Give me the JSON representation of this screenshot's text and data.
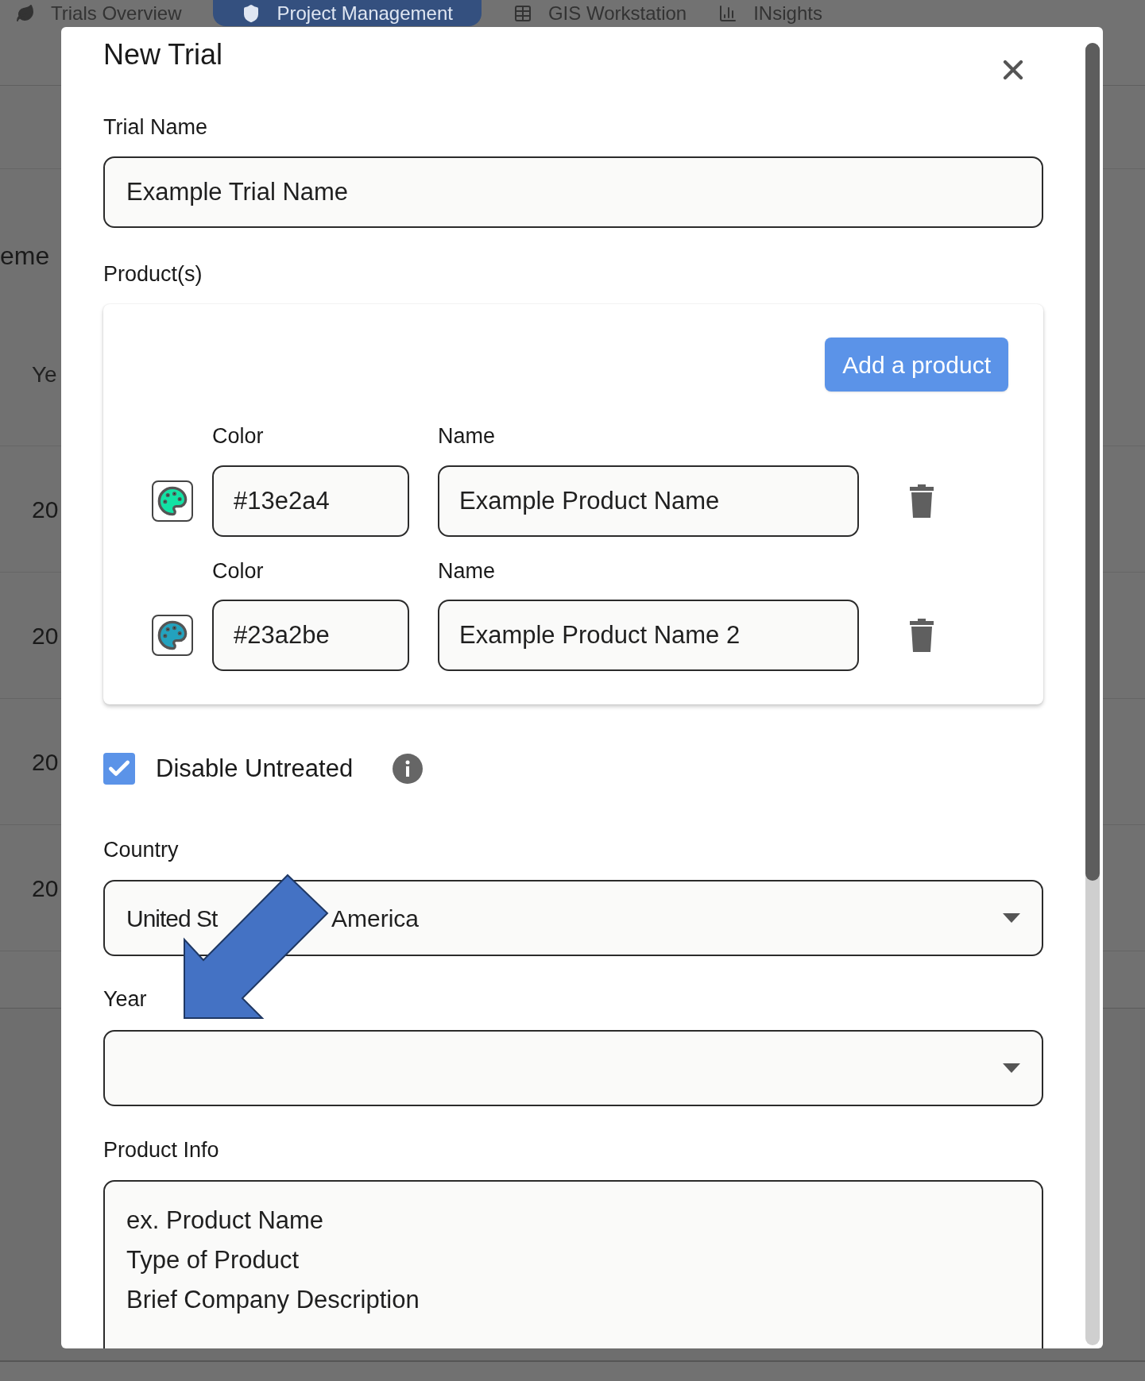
{
  "background": {
    "nav_tabs": [
      {
        "label": "Trials Overview",
        "selected": false,
        "kind": "leaf"
      },
      {
        "label": "Project Management",
        "selected": true,
        "kind": "shield"
      },
      {
        "label": "GIS Workstation",
        "selected": false,
        "kind": "table"
      },
      {
        "label": "INsights",
        "selected": false,
        "kind": "chart"
      }
    ],
    "heading_fragment": "eme",
    "column_fragment": "Ye",
    "row_fragments": [
      "20",
      "20",
      "20",
      "20"
    ]
  },
  "dialog": {
    "title": "New Trial",
    "trial_name": {
      "label": "Trial Name",
      "value": "Example Trial Name"
    },
    "products": {
      "label": "Product(s)",
      "add_button": "Add a product",
      "items": [
        {
          "color_label": "Color",
          "color": "#13e2a4",
          "name_label": "Name",
          "name": "Example Product Name"
        },
        {
          "color_label": "Color",
          "color": "#23a2be",
          "name_label": "Name",
          "name": "Example Product Name 2"
        }
      ]
    },
    "disable_untreated": {
      "label": "Disable Untreated",
      "checked": true
    },
    "country": {
      "label": "Country",
      "visible_value_parts": [
        "United St",
        "America"
      ]
    },
    "year": {
      "label": "Year"
    },
    "product_info": {
      "label": "Product Info",
      "lines": [
        "ex. Product Name",
        "Type of Product",
        "Brief Company Description"
      ]
    }
  }
}
